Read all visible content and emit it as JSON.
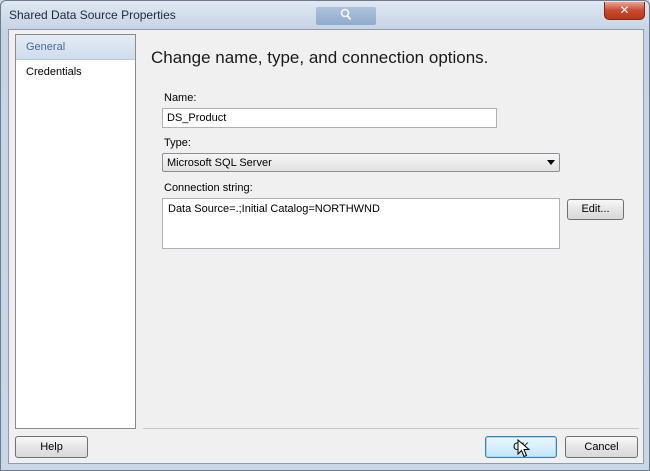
{
  "window": {
    "title": "Shared Data Source Properties",
    "close_glyph": "✕"
  },
  "nav": {
    "items": [
      {
        "label": "General",
        "selected": true
      },
      {
        "label": "Credentials",
        "selected": false
      }
    ]
  },
  "main": {
    "heading": "Change name, type, and connection options.",
    "name_label": "Name:",
    "name_value": "DS_Product",
    "type_label": "Type:",
    "type_value": "Microsoft SQL Server",
    "connection_label": "Connection string:",
    "connection_value": "Data Source=.;Initial Catalog=NORTHWND",
    "edit_label": "Edit..."
  },
  "footer": {
    "help_label": "Help",
    "ok_label": "OK",
    "cancel_label": "Cancel"
  },
  "colors": {
    "accent": "#3c7fb1",
    "selected_nav_text": "#4a6a92",
    "close_button": "#c74a2f"
  }
}
